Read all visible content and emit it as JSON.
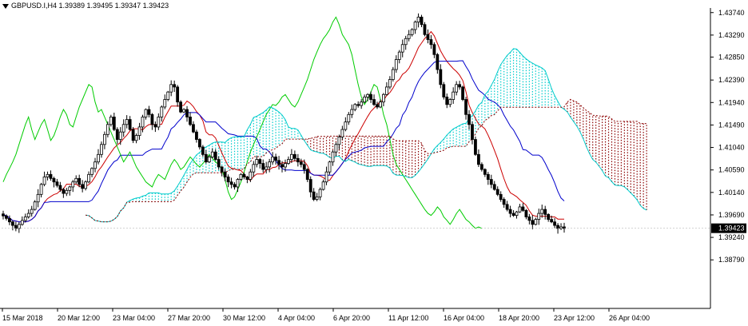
{
  "header": {
    "symbol_line": "GBPUSD.I,H4  1.39389 1.39495 1.39347 1.39423"
  },
  "chart_data": {
    "type": "candlestick",
    "symbol": "GBPUSD.I",
    "timeframe": "H4",
    "ohlc_last": {
      "open": 1.39389,
      "high": 1.39495,
      "low": 1.39347,
      "close": 1.39423
    },
    "current_price_label": "1.39423",
    "ylim": [
      1.3785,
      1.438
    ],
    "y_ticks": [
      "1.43740",
      "1.43290",
      "1.42850",
      "1.42390",
      "1.41940",
      "1.41490",
      "1.41040",
      "1.40590",
      "1.40140",
      "1.39690",
      "1.39240",
      "1.38790"
    ],
    "x_ticks": [
      "15 Mar 2018",
      "20 Mar 12:00",
      "23 Mar 04:00",
      "27 Mar 20:00",
      "30 Mar 12:00",
      "4 Apr 04:00",
      "6 Apr 20:00",
      "11 Apr 12:00",
      "16 Apr 04:00",
      "18 Apr 20:00",
      "23 Apr 12:00",
      "26 Apr 04:00"
    ],
    "indicators": [
      "Ichimoku Kinko Hyo"
    ],
    "colors": {
      "background": "#ffffff",
      "candle": "#000000",
      "tenkan": "#cc0000",
      "kijun": "#0000cc",
      "chikou": "#00cc00",
      "kumo_bear": "#8b0000",
      "kumo_bull": "#00cccc",
      "current_price_box": "#000000"
    },
    "closes": [
      1.3967,
      1.3962,
      1.3955,
      1.3948,
      1.3942,
      1.395,
      1.3958,
      1.3965,
      1.3972,
      1.398,
      1.3995,
      1.401,
      1.403,
      1.4045,
      1.405,
      1.4042,
      1.4035,
      1.4028,
      1.402,
      1.4012,
      1.4018,
      1.4025,
      1.4035,
      1.4042,
      1.403,
      1.4022,
      1.4035,
      1.405,
      1.4062,
      1.4075,
      1.409,
      1.411,
      1.413,
      1.415,
      1.4165,
      1.414,
      1.412,
      1.4135,
      1.415,
      1.416,
      1.414,
      1.4118,
      1.4128,
      1.4145,
      1.4165,
      1.418,
      1.417,
      1.415,
      1.4145,
      1.4165,
      1.4185,
      1.42,
      1.4215,
      1.423,
      1.4225,
      1.4195,
      1.4175,
      1.418,
      1.4165,
      1.415,
      1.4135,
      1.412,
      1.4105,
      1.409,
      1.4075,
      1.4085,
      1.4095,
      1.408,
      1.4065,
      1.4055,
      1.4045,
      1.4035,
      1.403,
      1.4025,
      1.404,
      1.405,
      1.4045,
      1.404,
      1.4055,
      1.407,
      1.408,
      1.4072,
      1.406,
      1.4065,
      1.4075,
      1.4085,
      1.4078,
      1.407,
      1.4065,
      1.4072,
      1.408,
      1.409,
      1.4082,
      1.4075,
      1.407,
      1.406,
      1.404,
      1.4015,
      1.4,
      1.4005,
      1.402,
      1.4035,
      1.4055,
      1.4075,
      1.4095,
      1.411,
      1.4125,
      1.414,
      1.4155,
      1.417,
      1.418,
      1.419,
      1.4188,
      1.4195,
      1.4205,
      1.421,
      1.42,
      1.419,
      1.4185,
      1.4195,
      1.421,
      1.4225,
      1.424,
      1.426,
      1.428,
      1.4295,
      1.431,
      1.4322,
      1.433,
      1.434,
      1.4355,
      1.4365,
      1.435,
      1.433,
      1.432,
      1.431,
      1.429,
      1.426,
      1.423,
      1.4205,
      1.419,
      1.42,
      1.4215,
      1.423,
      1.4225,
      1.42,
      1.417,
      1.415,
      1.412,
      1.409,
      1.407,
      1.406,
      1.405,
      1.404,
      1.403,
      1.402,
      1.401,
      1.4,
      1.399,
      1.398,
      1.3972,
      1.3968,
      1.3975,
      1.3985,
      1.3978,
      1.3965,
      1.3958,
      1.395,
      1.396,
      1.3972,
      1.398,
      1.397,
      1.396,
      1.3955,
      1.3948,
      1.3942,
      1.3945,
      1.3942
    ]
  }
}
